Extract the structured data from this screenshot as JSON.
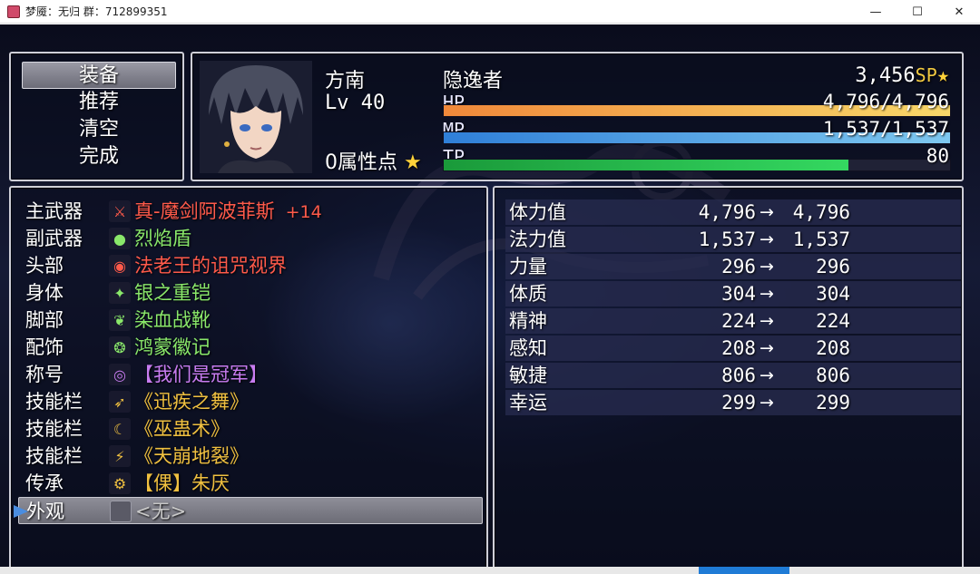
{
  "window": {
    "title": "梦魇：无归 群：712899351",
    "minimize": "—",
    "maximize": "☐",
    "close": "✕"
  },
  "menu": {
    "items": [
      {
        "label": "装备",
        "selected": true
      },
      {
        "label": "推荐",
        "selected": false
      },
      {
        "label": "清空",
        "selected": false
      },
      {
        "label": "完成",
        "selected": false
      }
    ]
  },
  "actor": {
    "name": "方南",
    "level": "Lv 40",
    "class": "隐逸者",
    "sp": "3,456",
    "sp_unit": "SP",
    "attr_points": "0属性点",
    "hp_label": "HP",
    "hp_value": "4,796/4,796",
    "hp_ratio": 1.0,
    "mp_label": "MP",
    "mp_value": "1,537/1,537",
    "mp_ratio": 1.0,
    "tp_label": "TP",
    "tp_value": "80",
    "tp_ratio": 0.8
  },
  "colors": {
    "hp": [
      "#f0883a",
      "#f8d86a"
    ],
    "mp": [
      "#2f7fd8",
      "#7ec8f0"
    ],
    "tp": [
      "#1a9a3a",
      "#34d860"
    ],
    "item_red": "#ff5a4a",
    "item_green": "#8ae86a",
    "item_purple": "#c87cf0",
    "item_gold": "#f0c040",
    "item_gray": "#c8c8c8"
  },
  "equipment": [
    {
      "slot": "主武器",
      "icon": "sword-icon",
      "glyph": "⚔",
      "name": "真-魔剑阿波菲斯",
      "plus": "+14",
      "color": "#ff5a4a"
    },
    {
      "slot": "副武器",
      "icon": "shield-icon",
      "glyph": "●",
      "name": "烈焰盾",
      "plus": "",
      "color": "#8ae86a"
    },
    {
      "slot": "头部",
      "icon": "helmet-icon",
      "glyph": "◉",
      "name": "法老王的诅咒视界",
      "plus": "",
      "color": "#ff5a4a"
    },
    {
      "slot": "身体",
      "icon": "armor-icon",
      "glyph": "✦",
      "name": "银之重铠",
      "plus": "",
      "color": "#8ae86a"
    },
    {
      "slot": "脚部",
      "icon": "boots-icon",
      "glyph": "❦",
      "name": "染血战靴",
      "plus": "",
      "color": "#8ae86a"
    },
    {
      "slot": "配饰",
      "icon": "badge-icon",
      "glyph": "❂",
      "name": "鸿蒙徽记",
      "plus": "",
      "color": "#8ae86a"
    },
    {
      "slot": "称号",
      "icon": "title-icon",
      "glyph": "◎",
      "name": "【我们是冠军】",
      "plus": "",
      "color": "#c87cf0"
    },
    {
      "slot": "技能栏",
      "icon": "skill-dance-icon",
      "glyph": "➶",
      "name": "《迅疾之舞》",
      "plus": "",
      "color": "#f0c040"
    },
    {
      "slot": "技能栏",
      "icon": "skill-witchcraft-icon",
      "glyph": "☾",
      "name": "《巫蛊术》",
      "plus": "",
      "color": "#f0c040"
    },
    {
      "slot": "技能栏",
      "icon": "skill-quake-icon",
      "glyph": "⚡",
      "name": "《天崩地裂》",
      "plus": "",
      "color": "#f0c040"
    },
    {
      "slot": "传承",
      "icon": "inheritance-icon",
      "glyph": "⚙",
      "name": "【倮】朱厌",
      "plus": "",
      "color": "#f0c040"
    },
    {
      "slot": "外观",
      "icon": "empty-slot-icon",
      "glyph": "",
      "name": "<无>",
      "plus": "",
      "color": "#c8c8c8",
      "selected": true
    }
  ],
  "stats": [
    {
      "name": "体力值",
      "current": "4,796",
      "new": "4,796"
    },
    {
      "name": "法力值",
      "current": "1,537",
      "new": "1,537"
    },
    {
      "name": "力量",
      "current": "296",
      "new": "296"
    },
    {
      "name": "体质",
      "current": "304",
      "new": "304"
    },
    {
      "name": "精神",
      "current": "224",
      "new": "224"
    },
    {
      "name": "感知",
      "current": "208",
      "new": "208"
    },
    {
      "name": "敏捷",
      "current": "806",
      "new": "806"
    },
    {
      "name": "幸运",
      "current": "299",
      "new": "299"
    }
  ],
  "arrow": "→"
}
